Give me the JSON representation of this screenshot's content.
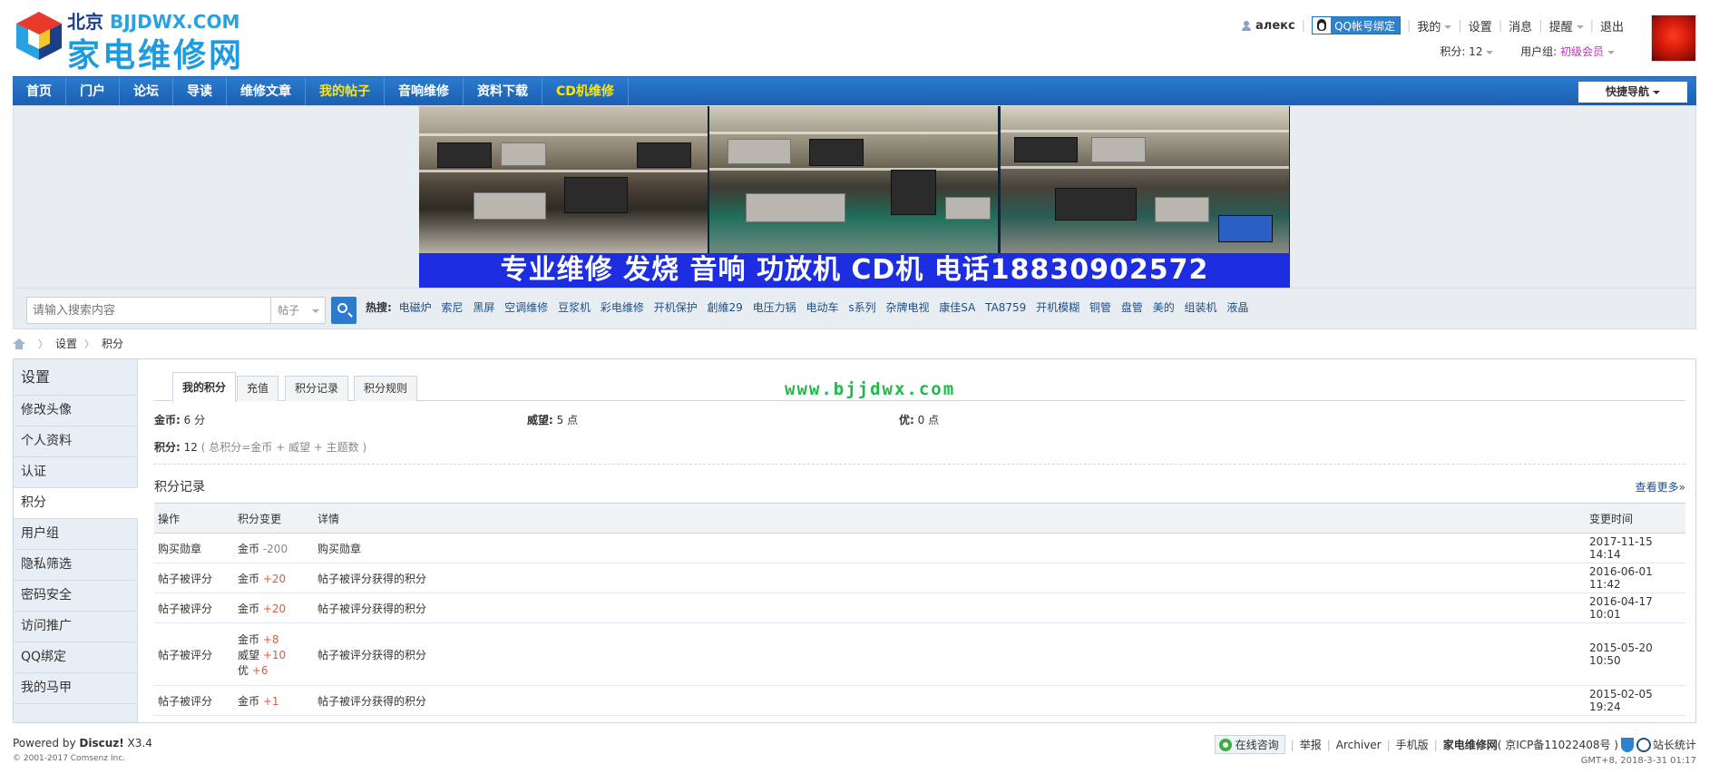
{
  "logo": {
    "top_city": "北京",
    "top_url": "BJJDWX.COM",
    "main": "家电维修网"
  },
  "user": {
    "name": "алекс",
    "qq_bind": "QQ帐号绑定",
    "menu": [
      "我的",
      "设置",
      "消息",
      "提醒",
      "退出"
    ],
    "credits_label": "积分: 12",
    "group_label": "用户组: ",
    "group_value": "初级会员"
  },
  "nav": {
    "items": [
      {
        "label": "首页",
        "highlight": false
      },
      {
        "label": "门户",
        "highlight": false
      },
      {
        "label": "论坛",
        "highlight": false
      },
      {
        "label": "导读",
        "highlight": false
      },
      {
        "label": "维修文章",
        "highlight": false
      },
      {
        "label": "我的帖子",
        "highlight": true
      },
      {
        "label": "音响维修",
        "highlight": false
      },
      {
        "label": "资料下载",
        "highlight": false
      },
      {
        "label": "CD机维修",
        "highlight": true
      }
    ],
    "quick_nav": "快捷导航"
  },
  "banner": {
    "text": "专业维修  发烧 音响 功放机 CD机 电话18830902572"
  },
  "search": {
    "placeholder": "请输入搜索内容",
    "type": "帖子",
    "hot_label": "热搜:",
    "hot": [
      "电磁炉",
      "索尼",
      "黑屏",
      "空调维修",
      "豆浆机",
      "彩电维修",
      "开机保护",
      "創維29",
      "电压力锅",
      "电动车",
      "s系列",
      "杂牌电视",
      "康佳SA",
      "TA8759",
      "开机模糊",
      "铜管",
      "盘管",
      "美的",
      "组装机",
      "液晶"
    ]
  },
  "breadcrumb": [
    "设置",
    "积分"
  ],
  "sidebar": {
    "title": "设置",
    "items": [
      {
        "label": "修改头像",
        "active": false
      },
      {
        "label": "个人资料",
        "active": false
      },
      {
        "label": "认证",
        "active": false
      },
      {
        "label": "积分",
        "active": true
      },
      {
        "label": "用户组",
        "active": false
      },
      {
        "label": "隐私筛选",
        "active": false
      },
      {
        "label": "密码安全",
        "active": false
      },
      {
        "label": "访问推广",
        "active": false
      },
      {
        "label": "QQ绑定",
        "active": false
      },
      {
        "label": "我的马甲",
        "active": false
      }
    ]
  },
  "tabs": [
    {
      "label": "我的积分",
      "active": true
    },
    {
      "label": "充值",
      "active": false
    },
    {
      "label": "积分记录",
      "active": false
    },
    {
      "label": "积分规则",
      "active": false
    }
  ],
  "watermark": "www.bjjdwx.com",
  "credits": {
    "gold_label": "金币:",
    "gold_value": " 6 分",
    "prestige_label": "威望:",
    "prestige_value": " 5 点",
    "you_label": "优:",
    "you_value": " 0 点",
    "total_label": "积分:",
    "total_value": " 12",
    "total_note": " ( 总积分=金币 + 威望 + 主题数 )"
  },
  "log": {
    "title": "积分记录",
    "more": "查看更多»",
    "headers": [
      "操作",
      "积分变更",
      "详情",
      "变更时间"
    ],
    "rows": [
      {
        "op": "购买勋章",
        "changes": [
          {
            "name": "金币",
            "value": "-200",
            "sign": "neg"
          }
        ],
        "detail": "购买勋章",
        "time": "2017-11-15 14:14"
      },
      {
        "op": "帖子被评分",
        "changes": [
          {
            "name": "金币",
            "value": "+20",
            "sign": "pos"
          }
        ],
        "detail": "帖子被评分获得的积分",
        "time": "2016-06-01 11:42"
      },
      {
        "op": "帖子被评分",
        "changes": [
          {
            "name": "金币",
            "value": "+20",
            "sign": "pos"
          }
        ],
        "detail": "帖子被评分获得的积分",
        "time": "2016-04-17 10:01"
      },
      {
        "op": "帖子被评分",
        "changes": [
          {
            "name": "金币",
            "value": "+8",
            "sign": "pos"
          },
          {
            "name": "威望",
            "value": "+10",
            "sign": "pos"
          },
          {
            "name": "优",
            "value": "+6",
            "sign": "pos"
          }
        ],
        "detail": "帖子被评分获得的积分",
        "time": "2015-05-20 10:50"
      },
      {
        "op": "帖子被评分",
        "changes": [
          {
            "name": "金币",
            "value": "+1",
            "sign": "pos"
          }
        ],
        "detail": "帖子被评分获得的积分",
        "time": "2015-02-05 19:24"
      }
    ]
  },
  "footer": {
    "powered": "Powered by ",
    "discuz": "Discuz!",
    "version": " X3.4",
    "copyright": "© 2001-2017 Comsenz Inc.",
    "consult": "在线咨询",
    "links": [
      "举报",
      "Archiver",
      "手机版"
    ],
    "site": "家电维修网",
    "icp": " ( 京ICP备11022408号 )",
    "stats": "站长统计",
    "time": "GMT+8, 2018-3-31 01:17"
  }
}
